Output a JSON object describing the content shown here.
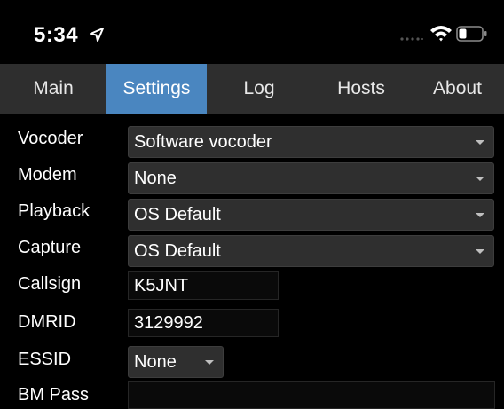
{
  "status_bar": {
    "time": "5:34",
    "icons": [
      "location-arrow-icon",
      "cellular-signal-icon",
      "wifi-icon",
      "battery-icon"
    ]
  },
  "tabs": [
    {
      "label": "Main",
      "active": false
    },
    {
      "label": "Settings",
      "active": true
    },
    {
      "label": "Log",
      "active": false
    },
    {
      "label": "Hosts",
      "active": false
    },
    {
      "label": "About",
      "active": false
    }
  ],
  "colors": {
    "active_tab": "#4a86c0",
    "tab_bar": "#2e2e2e",
    "select_bg": "#2f2f2f",
    "background": "#000000"
  },
  "settings": {
    "vocoder": {
      "label": "Vocoder",
      "value": "Software vocoder"
    },
    "modem": {
      "label": "Modem",
      "value": "None"
    },
    "playback": {
      "label": "Playback",
      "value": "OS Default"
    },
    "capture": {
      "label": "Capture",
      "value": "OS Default"
    },
    "callsign": {
      "label": "Callsign",
      "value": "K5JNT"
    },
    "dmrid": {
      "label": "DMRID",
      "value": "3129992"
    },
    "essid": {
      "label": "ESSID",
      "value": "None"
    },
    "bm_pass": {
      "label": "BM Pass",
      "value": ""
    }
  }
}
